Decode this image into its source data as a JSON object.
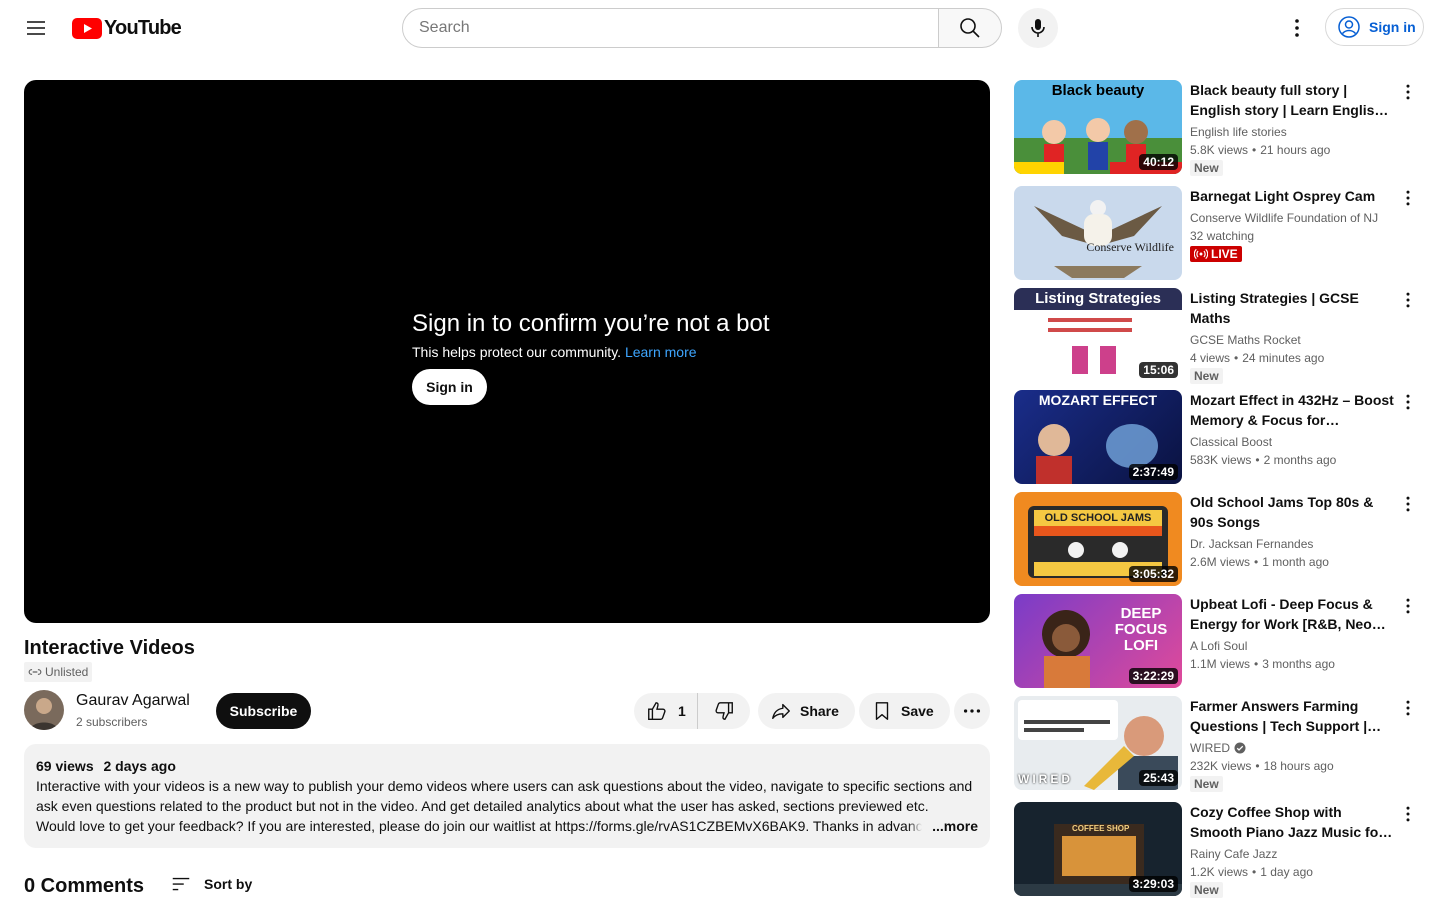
{
  "header": {
    "logo_text": "YouTube",
    "search_placeholder": "Search",
    "signin_label": "Sign in"
  },
  "player": {
    "bot_title": "Sign in to confirm you’re not a bot",
    "bot_subtitle": "This helps protect our community.",
    "learn_more": "Learn more",
    "signin_label": "Sign in"
  },
  "video": {
    "title": "Interactive Videos",
    "visibility": "Unlisted",
    "channel_name": "Gaurav Agarwal",
    "subscribers": "2 subscribers",
    "subscribe_label": "Subscribe",
    "likes": "1",
    "share_label": "Share",
    "save_label": "Save"
  },
  "description": {
    "views": "69 views",
    "date": "2 days ago",
    "line1": "Interactive with your videos is a new way to publish your demo videos where users can ask questions about the video, navigate to specific sections and",
    "line2": "ask even questions related to the product but not in the video. And get detailed analytics about what the user has asked, sections previewed etc.",
    "line3": "Would love to get your feedback? If you are interested, please do join our waitlist at https://forms.gle/rvAS1CZBEMvX6BAK9.  Thanks in advance.",
    "more_label": "...more"
  },
  "comments": {
    "count_label": "0 Comments",
    "sort_label": "Sort by"
  },
  "recommendations": [
    {
      "title": "Black beauty full story | English story | Learn English | English…",
      "channel": "English life stories",
      "views": "5.8K views",
      "age": "21 hours ago",
      "duration": "40:12",
      "badge": "New",
      "thumb_text": "Black beauty"
    },
    {
      "title": "Barnegat Light Osprey Cam",
      "channel": "Conserve Wildlife Foundation of NJ",
      "views": "32 watching",
      "age": "",
      "duration": "",
      "badge": "LIVE",
      "thumb_text": "Conserve Wildlife"
    },
    {
      "title": "Listing Strategies | GCSE Maths",
      "channel": "GCSE Maths Rocket",
      "views": "4 views",
      "age": "24 minutes ago",
      "duration": "15:06",
      "badge": "New",
      "thumb_text": "Listing Strategies"
    },
    {
      "title": "Mozart Effect in 432Hz – Boost Memory & Focus for Effective…",
      "channel": "Classical Boost",
      "views": "583K views",
      "age": "2 months ago",
      "duration": "2:37:49",
      "badge": "",
      "thumb_text": "MOZART EFFECT"
    },
    {
      "title": "Old School Jams Top 80s & 90s Songs",
      "channel": "Dr. Jacksan Fernandes",
      "views": "2.6M views",
      "age": "1 month ago",
      "duration": "3:05:32",
      "badge": "",
      "thumb_text": "OLD SCHOOL JAMS"
    },
    {
      "title": "Upbeat Lofi - Deep Focus & Energy for Work [R&B, Neo So…",
      "channel": "A Lofi Soul",
      "views": "1.1M views",
      "age": "3 months ago",
      "duration": "3:22:29",
      "badge": "",
      "thumb_text": "DEEP FOCUS LOFI"
    },
    {
      "title": "Farmer Answers Farming Questions | Tech Support |…",
      "channel": "WIRED",
      "views": "232K views",
      "age": "18 hours ago",
      "duration": "25:43",
      "badge": "New",
      "thumb_text": "WIRED",
      "verified": true
    },
    {
      "title": "Cozy Coffee Shop with Smooth Piano Jazz Music for Relaxing…",
      "channel": "Rainy Cafe Jazz",
      "views": "1.2K views",
      "age": "1 day ago",
      "duration": "3:29:03",
      "badge": "New",
      "thumb_text": "COFFEE SHOP"
    }
  ],
  "colors": {
    "brand_red": "#ff0000",
    "link_blue": "#065fd4",
    "live_red": "#cc0000"
  }
}
